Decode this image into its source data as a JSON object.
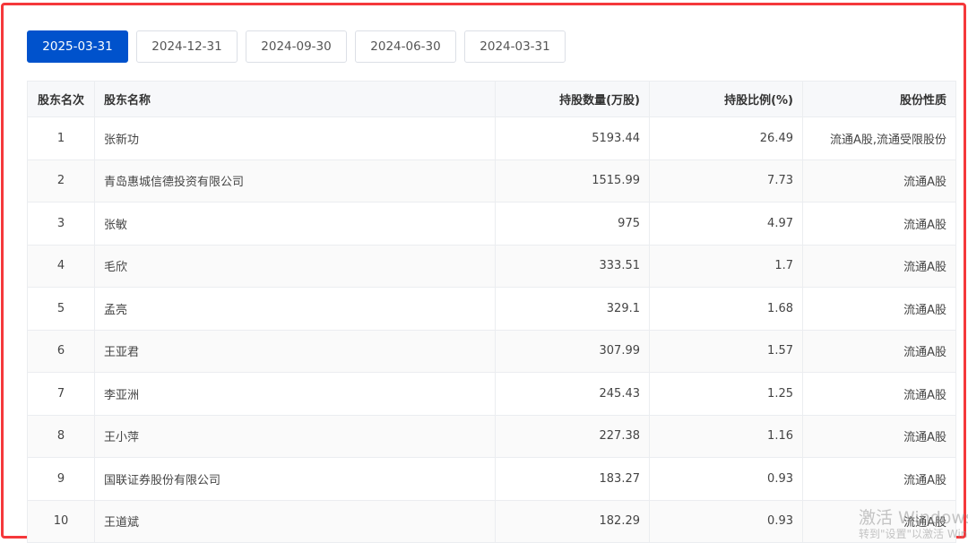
{
  "tabs": [
    "2025-03-31",
    "2024-12-31",
    "2024-09-30",
    "2024-06-30",
    "2024-03-31"
  ],
  "active_tab": "2025-03-31",
  "table": {
    "headers": [
      "股东名次",
      "股东名称",
      "持股数量(万股)",
      "持股比例(%)",
      "股份性质"
    ],
    "rows": [
      [
        "1",
        "张新功",
        "5193.44",
        "26.49",
        "流通A股,流通受限股份"
      ],
      [
        "2",
        "青岛惠城信德投资有限公司",
        "1515.99",
        "7.73",
        "流通A股"
      ],
      [
        "3",
        "张敏",
        "975",
        "4.97",
        "流通A股"
      ],
      [
        "4",
        "毛欣",
        "333.51",
        "1.7",
        "流通A股"
      ],
      [
        "5",
        "孟亮",
        "329.1",
        "1.68",
        "流通A股"
      ],
      [
        "6",
        "王亚君",
        "307.99",
        "1.57",
        "流通A股"
      ],
      [
        "7",
        "李亚洲",
        "245.43",
        "1.25",
        "流通A股"
      ],
      [
        "8",
        "王小萍",
        "227.38",
        "1.16",
        "流通A股"
      ],
      [
        "9",
        "国联证券股份有限公司",
        "183.27",
        "0.93",
        "流通A股"
      ],
      [
        "10",
        "王道斌",
        "182.29",
        "0.93",
        "流通A股"
      ]
    ]
  },
  "watermark": {
    "line1": "激活 Windows",
    "line2": "转到\"设置\"以激活 Windows"
  },
  "colors": {
    "accent": "#0052cc",
    "frame": "#f5383b"
  }
}
